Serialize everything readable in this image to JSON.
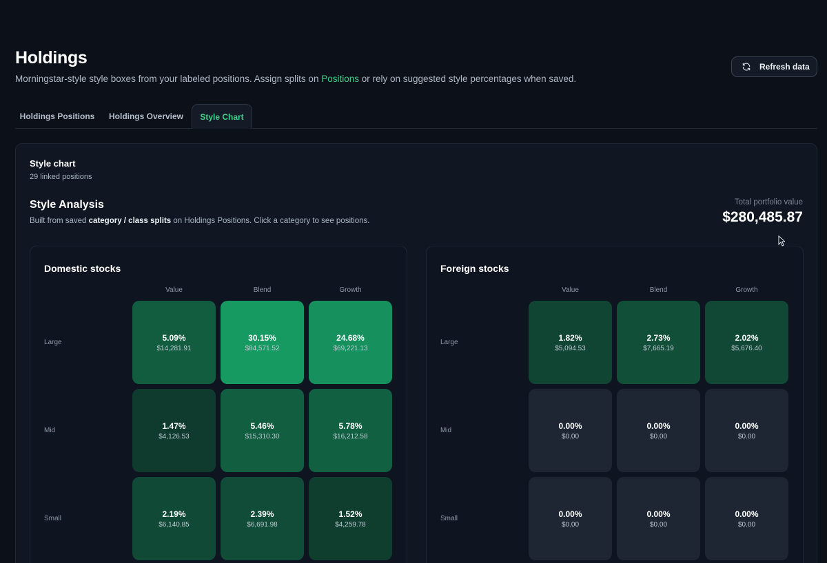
{
  "page": {
    "title": "Holdings",
    "subtitle_before": "Morningstar-style style boxes from your labeled positions. Assign splits on ",
    "subtitle_link": "Positions",
    "subtitle_after": " or rely on suggested style percentages when saved.",
    "refresh_label": "Refresh data",
    "refresh_icon": "refresh-icon"
  },
  "tabs": [
    {
      "label": "Holdings Positions",
      "active": false
    },
    {
      "label": "Holdings Overview",
      "active": false
    },
    {
      "label": "Style Chart",
      "active": true
    }
  ],
  "panel": {
    "title": "Style chart",
    "subtitle": "29 linked positions",
    "analysis_title": "Style Analysis",
    "analysis_sub_before": "Built from saved ",
    "analysis_sub_bold": "category / class splits",
    "analysis_sub_after": " on Holdings Positions. Click a category to see positions.",
    "total_label": "Total portfolio value",
    "total_value": "$280,485.87"
  },
  "style_boxes": [
    {
      "title": "Domestic stocks",
      "columns": [
        "Value",
        "Blend",
        "Growth"
      ],
      "rows": [
        {
          "label": "Large",
          "cells": [
            {
              "pct": "5.09%",
              "amt": "$14,281.91",
              "value": 5.09
            },
            {
              "pct": "30.15%",
              "amt": "$84,571.52",
              "value": 30.15
            },
            {
              "pct": "24.68%",
              "amt": "$69,221.13",
              "value": 24.68
            }
          ]
        },
        {
          "label": "Mid",
          "cells": [
            {
              "pct": "1.47%",
              "amt": "$4,126.53",
              "value": 1.47
            },
            {
              "pct": "5.46%",
              "amt": "$15,310.30",
              "value": 5.46
            },
            {
              "pct": "5.78%",
              "amt": "$16,212.58",
              "value": 5.78
            }
          ]
        },
        {
          "label": "Small",
          "cells": [
            {
              "pct": "2.19%",
              "amt": "$6,140.85",
              "value": 2.19
            },
            {
              "pct": "2.39%",
              "amt": "$6,691.98",
              "value": 2.39
            },
            {
              "pct": "1.52%",
              "amt": "$4,259.78",
              "value": 1.52
            }
          ]
        }
      ]
    },
    {
      "title": "Foreign stocks",
      "columns": [
        "Value",
        "Blend",
        "Growth"
      ],
      "rows": [
        {
          "label": "Large",
          "cells": [
            {
              "pct": "1.82%",
              "amt": "$5,094.53",
              "value": 1.82
            },
            {
              "pct": "2.73%",
              "amt": "$7,665.19",
              "value": 2.73
            },
            {
              "pct": "2.02%",
              "amt": "$5,676.40",
              "value": 2.02
            }
          ]
        },
        {
          "label": "Mid",
          "cells": [
            {
              "pct": "0.00%",
              "amt": "$0.00",
              "value": 0
            },
            {
              "pct": "0.00%",
              "amt": "$0.00",
              "value": 0
            },
            {
              "pct": "0.00%",
              "amt": "$0.00",
              "value": 0
            }
          ]
        },
        {
          "label": "Small",
          "cells": [
            {
              "pct": "0.00%",
              "amt": "$0.00",
              "value": 0
            },
            {
              "pct": "0.00%",
              "amt": "$0.00",
              "value": 0
            },
            {
              "pct": "0.00%",
              "amt": "$0.00",
              "value": 0
            }
          ]
        }
      ]
    }
  ],
  "colors": {
    "accent": "#3fd28a",
    "cell_empty": "#1e2633",
    "cell_low": "#0f3b2e",
    "cell_high": "#179a62"
  }
}
